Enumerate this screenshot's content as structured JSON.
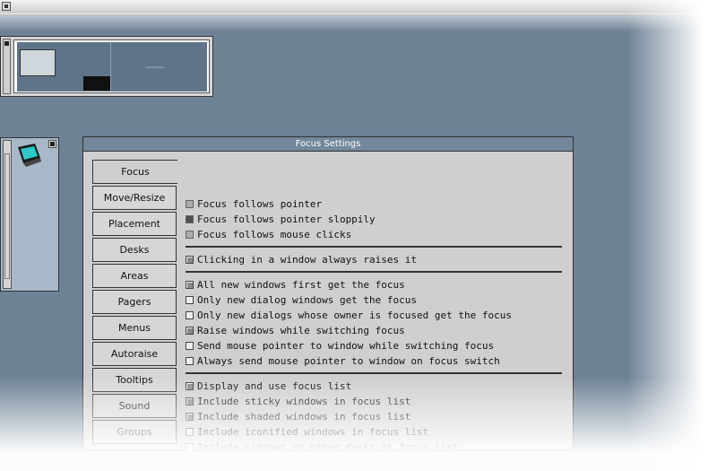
{
  "dialog": {
    "title": "Focus Settings",
    "tabs": [
      {
        "label": "Focus",
        "active": true
      },
      {
        "label": "Move/Resize"
      },
      {
        "label": "Placement"
      },
      {
        "label": "Desks"
      },
      {
        "label": "Areas"
      },
      {
        "label": "Pagers"
      },
      {
        "label": "Menus"
      },
      {
        "label": "Autoraise"
      },
      {
        "label": "Tooltips"
      },
      {
        "label": "Sound"
      },
      {
        "label": "Groups"
      }
    ],
    "focus_mode": {
      "options": [
        {
          "label": "Focus follows pointer",
          "selected": false
        },
        {
          "label": "Focus follows pointer sloppily",
          "selected": true
        },
        {
          "label": "Focus follows mouse clicks",
          "selected": false
        }
      ]
    },
    "raise": {
      "label": "Clicking in a window always raises it",
      "checked": true
    },
    "new_windows": [
      {
        "label": "All new windows first get the focus",
        "checked": true
      },
      {
        "label": "Only new dialog windows get the focus",
        "checked": false
      },
      {
        "label": "Only new dialogs whose owner is focused get the focus",
        "checked": false
      },
      {
        "label": "Raise windows while switching focus",
        "checked": true
      },
      {
        "label": "Send mouse pointer to window while switching focus",
        "checked": false
      },
      {
        "label": "Always send mouse pointer to window on focus switch",
        "checked": false
      }
    ],
    "focus_list": [
      {
        "label": "Display and use focus list",
        "checked": true
      },
      {
        "label": "Include sticky windows in focus list",
        "checked": true
      },
      {
        "label": "Include shaded windows in focus list",
        "checked": true
      },
      {
        "label": "Include iconified windows in focus list",
        "checked": false
      },
      {
        "label": "Include windows on other desks in focus list",
        "checked": false
      }
    ]
  },
  "colors": {
    "desktop": "#6e8296",
    "dialog_bg": "#cfcfcf",
    "titlebar": "#73889a",
    "dock_bg": "#a7b9c8"
  },
  "icons": {
    "dock_app": "monitor-icon"
  }
}
